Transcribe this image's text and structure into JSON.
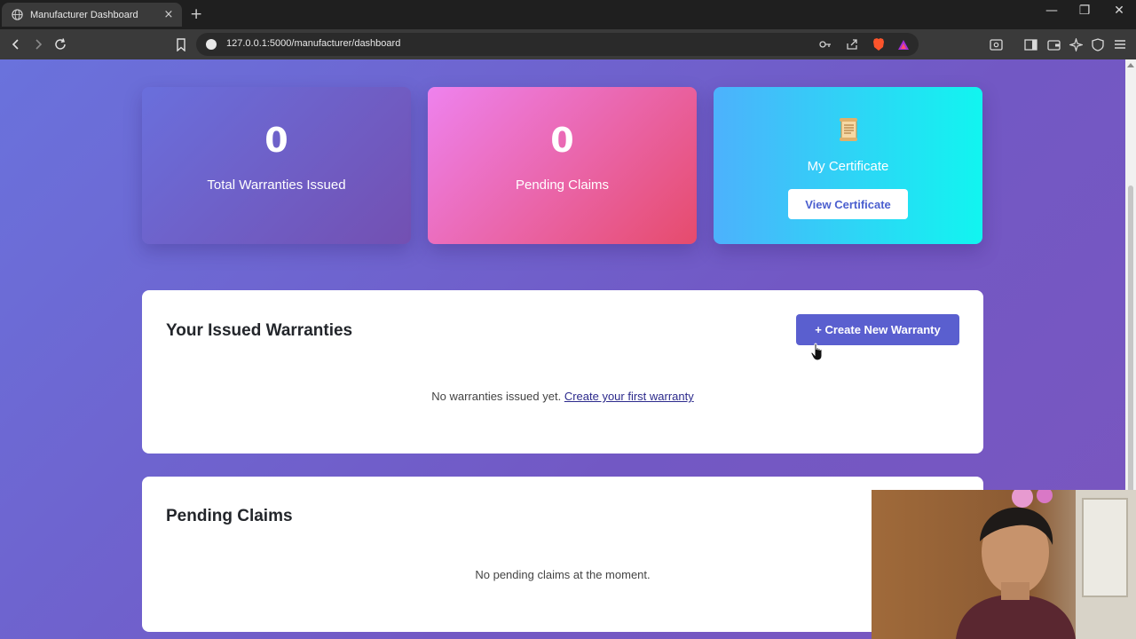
{
  "browser": {
    "tab_title": "Manufacturer Dashboard",
    "tab_close": "×",
    "new_tab": "+",
    "url": "127.0.0.1:5000/manufacturer/dashboard",
    "window_controls": [
      "—",
      "❐",
      "✕"
    ]
  },
  "stats": {
    "total_warranties": {
      "value": "0",
      "label": "Total Warranties Issued"
    },
    "pending_claims": {
      "value": "0",
      "label": "Pending Claims"
    },
    "certificate": {
      "icon": "scroll-icon",
      "label": "My Certificate",
      "button": "View Certificate"
    }
  },
  "warranties": {
    "title": "Your Issued Warranties",
    "create_button": "+ Create New Warranty",
    "empty_text": "No warranties issued yet.",
    "empty_link": "Create your first warranty"
  },
  "claims": {
    "title": "Pending Claims",
    "empty_text": "No pending claims at the moment."
  },
  "colors": {
    "page_bg": "#6f62cf",
    "total_card": "#6a6fdc",
    "pending_card": "#e9617f",
    "cert_card": "#2ad8f3",
    "primary_button": "#5a5fcf"
  }
}
